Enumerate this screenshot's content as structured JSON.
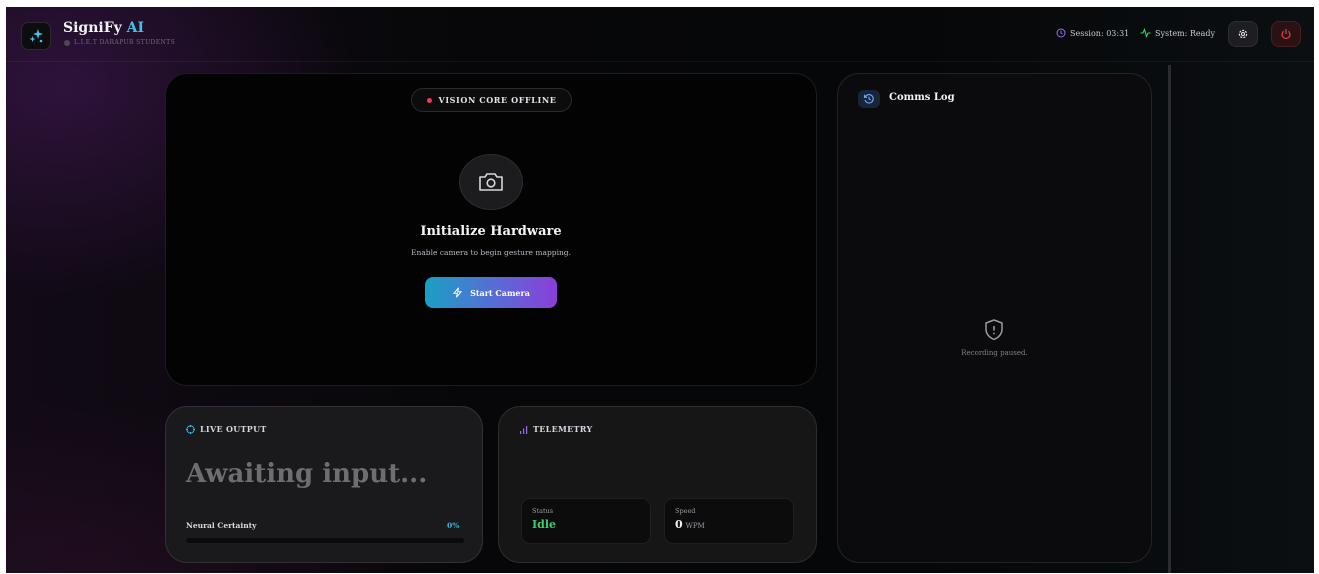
{
  "colors": {
    "accent_cyan": "#34b7e0",
    "accent_purple": "#8a3fd8",
    "status_red": "#ef3b4b",
    "status_green": "#3ccf6d"
  },
  "header": {
    "brand_name": "SigniFy",
    "brand_accent": "AI",
    "brand_subtitle": "L.I.E.T DARAPUR STUDENTS",
    "logo_icon": "sparkles-icon",
    "session": "Session: 03:31",
    "system_status": "System: Ready",
    "settings_icon": "gear-icon",
    "power_icon": "power-icon"
  },
  "vision": {
    "status_pill": "VISION CORE OFFLINE",
    "camera_icon": "camera-icon",
    "title": "Initialize Hardware",
    "subtitle": "Enable camera to begin gesture mapping.",
    "start_button": "Start Camera",
    "start_icon": "bolt-icon"
  },
  "comms": {
    "title": "Comms Log",
    "icon": "history-icon",
    "empty_icon": "shield-alert-icon",
    "empty_text": "Recording paused."
  },
  "live_output": {
    "label": "LIVE OUTPUT",
    "icon": "target-icon",
    "text": "Awaiting input...",
    "certainty_label": "Neural Certainty",
    "certainty_value": "0%",
    "certainty_fraction": 0
  },
  "telemetry": {
    "label": "TELEMETRY",
    "icon": "signal-bars-icon",
    "status_label": "Status",
    "status_value": "Idle",
    "speed_label": "Speed",
    "speed_value": "0",
    "speed_unit": "WPM"
  }
}
